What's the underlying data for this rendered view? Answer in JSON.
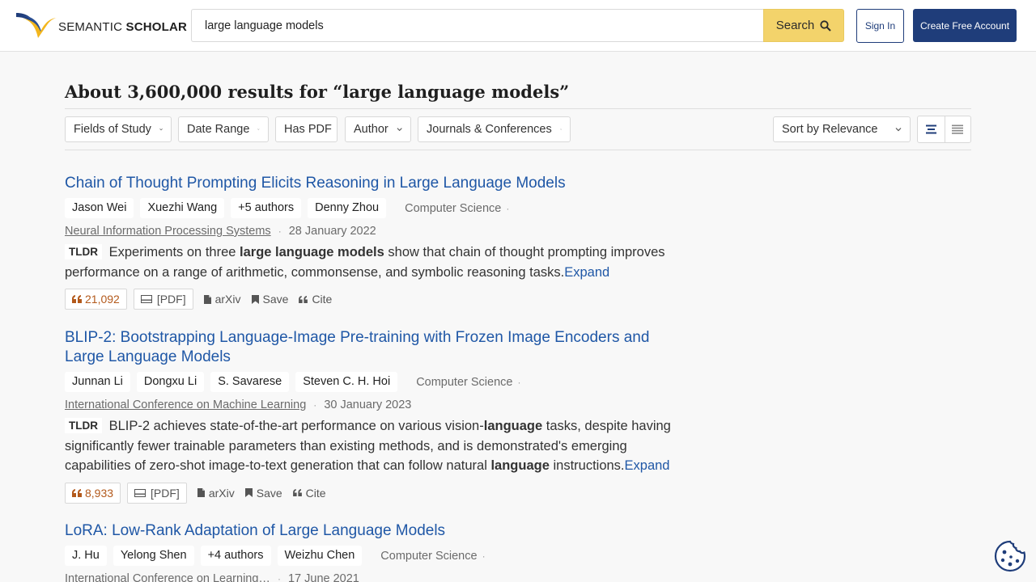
{
  "brand": {
    "name_light": "SEMANTIC",
    "name_bold": "SCHOLAR"
  },
  "search": {
    "value": "large language models",
    "button_label": "Search"
  },
  "auth": {
    "signin_label": "Sign In",
    "create_label": "Create Free Account"
  },
  "results_heading": "About 3,600,000 results for “large language models”",
  "filters": [
    "Fields of Study",
    "Date Range",
    "Has PDF",
    "Author",
    "Journals & Conferences"
  ],
  "sort": {
    "label": "Sort by Relevance"
  },
  "results": [
    {
      "title": "Chain of Thought Prompting Elicits Reasoning in Large Language Models",
      "authors": [
        "Jason Wei",
        "Xuezhi Wang",
        "+5 authors",
        "Denny Zhou"
      ],
      "field": "Computer Science",
      "venue": "Neural Information Processing Systems",
      "date": "28 January 2022",
      "tldr_label": "TLDR",
      "tldr_parts": [
        {
          "text": "Experiments on three ",
          "bold": false
        },
        {
          "text": "large language models",
          "bold": true
        },
        {
          "text": " show that chain of thought prompting improves performance on a range of arithmetic, commonsense, and symbolic reasoning tasks.",
          "bold": false
        }
      ],
      "expand_label": "Expand",
      "citations": "21,092",
      "pdf_label": "[PDF]",
      "source_label": "arXiv",
      "save_label": "Save",
      "cite_label": "Cite"
    },
    {
      "title": "BLIP-2: Bootstrapping Language-Image Pre-training with Frozen Image Encoders and Large Language Models",
      "authors": [
        "Junnan Li",
        "Dongxu Li",
        "S. Savarese",
        "Steven C. H. Hoi"
      ],
      "field": "Computer Science",
      "venue": "International Conference on Machine Learning",
      "date": "30 January 2023",
      "tldr_label": "TLDR",
      "tldr_parts": [
        {
          "text": "BLIP-2 achieves state-of-the-art performance on various vision-",
          "bold": false
        },
        {
          "text": "language",
          "bold": true
        },
        {
          "text": " tasks, despite having significantly fewer trainable parameters than existing methods, and is demonstrated's emerging capabilities of zero-shot image-to-text generation that can follow natural ",
          "bold": false
        },
        {
          "text": "language",
          "bold": true
        },
        {
          "text": " instructions.",
          "bold": false
        }
      ],
      "expand_label": "Expand",
      "citations": "8,933",
      "pdf_label": "[PDF]",
      "source_label": "arXiv",
      "save_label": "Save",
      "cite_label": "Cite"
    },
    {
      "title": "LoRA: Low-Rank Adaptation of Large Language Models",
      "authors": [
        "J. Hu",
        "Yelong Shen",
        "+4 authors",
        "Weizhu Chen"
      ],
      "field": "Computer Science",
      "venue": "International Conference on Learning…",
      "date": "17 June 2021"
    }
  ],
  "colors": {
    "link": "#1f57a6",
    "brand_navy": "#1f3d7a",
    "search_yellow": "#f3d36b",
    "citation": "#b3591b"
  }
}
